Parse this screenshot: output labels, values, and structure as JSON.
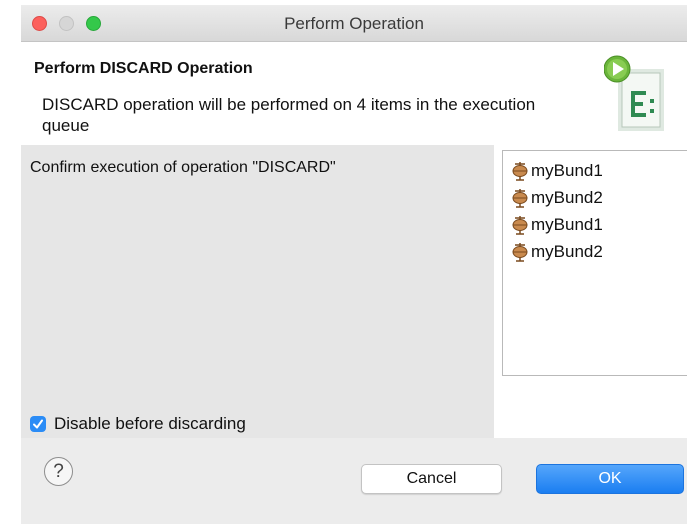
{
  "window": {
    "title": "Perform Operation"
  },
  "banner": {
    "title": "Perform DISCARD Operation",
    "description": "DISCARD operation will be performed on 4 items in the execution queue"
  },
  "confirm": {
    "text": "Confirm execution of operation \"DISCARD\""
  },
  "items": [
    {
      "label": "myBund1",
      "icon": "bundle-icon"
    },
    {
      "label": "myBund2",
      "icon": "bundle-icon"
    },
    {
      "label": "myBund1",
      "icon": "bundle-icon"
    },
    {
      "label": "myBund2",
      "icon": "bundle-icon"
    }
  ],
  "options": {
    "disable_before_discarding": {
      "label": "Disable before discarding",
      "checked": true
    }
  },
  "buttons": {
    "help_glyph": "?",
    "cancel": "Cancel",
    "ok": "OK"
  },
  "colors": {
    "accent": "#1b7ef1",
    "close": "#fc605c",
    "zoom": "#34c84a"
  }
}
